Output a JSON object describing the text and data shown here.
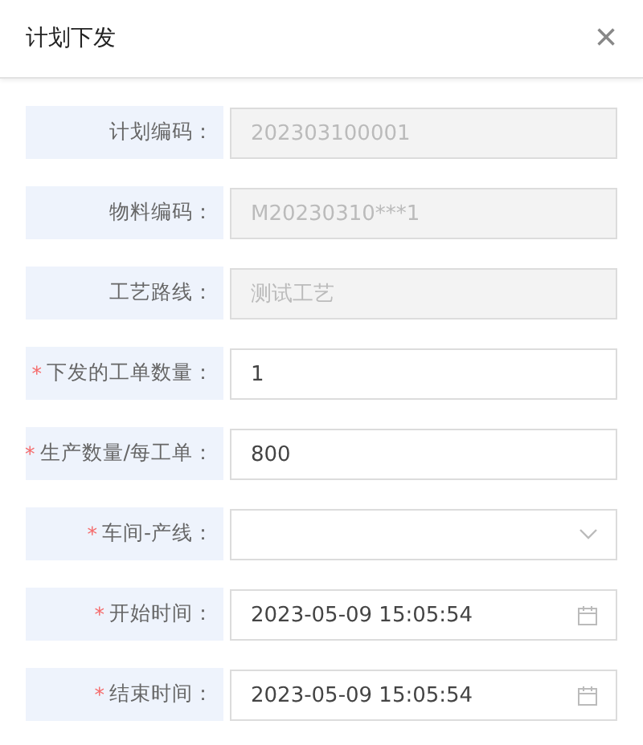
{
  "dialog": {
    "title": "计划下发",
    "close": "×"
  },
  "fields": [
    {
      "label": "计划编码：",
      "kind": "text",
      "disabled": true,
      "value": "202303100001"
    },
    {
      "label": "物料编码：",
      "kind": "text",
      "disabled": true,
      "value": "M20230310***1"
    },
    {
      "label": "工艺路线：",
      "kind": "text",
      "disabled": true,
      "value": "测试工艺"
    },
    {
      "label": "下发的工单数量：",
      "required_mark": "*",
      "kind": "text",
      "disabled": false,
      "value": "1"
    },
    {
      "label": "生产数量/每工单：",
      "required_mark": "*",
      "kind": "text",
      "disabled": false,
      "value": "800"
    },
    {
      "label": "车间-产线：",
      "required_mark": "*",
      "kind": "select",
      "disabled": false
    },
    {
      "label": "开始时间：",
      "required_mark": "*",
      "kind": "date",
      "disabled": false,
      "value": "2023-05-09 15:05:54"
    },
    {
      "label": "结束时间：",
      "required_mark": "*",
      "kind": "date",
      "disabled": false,
      "value": "2023-05-09 15:05:54"
    }
  ]
}
